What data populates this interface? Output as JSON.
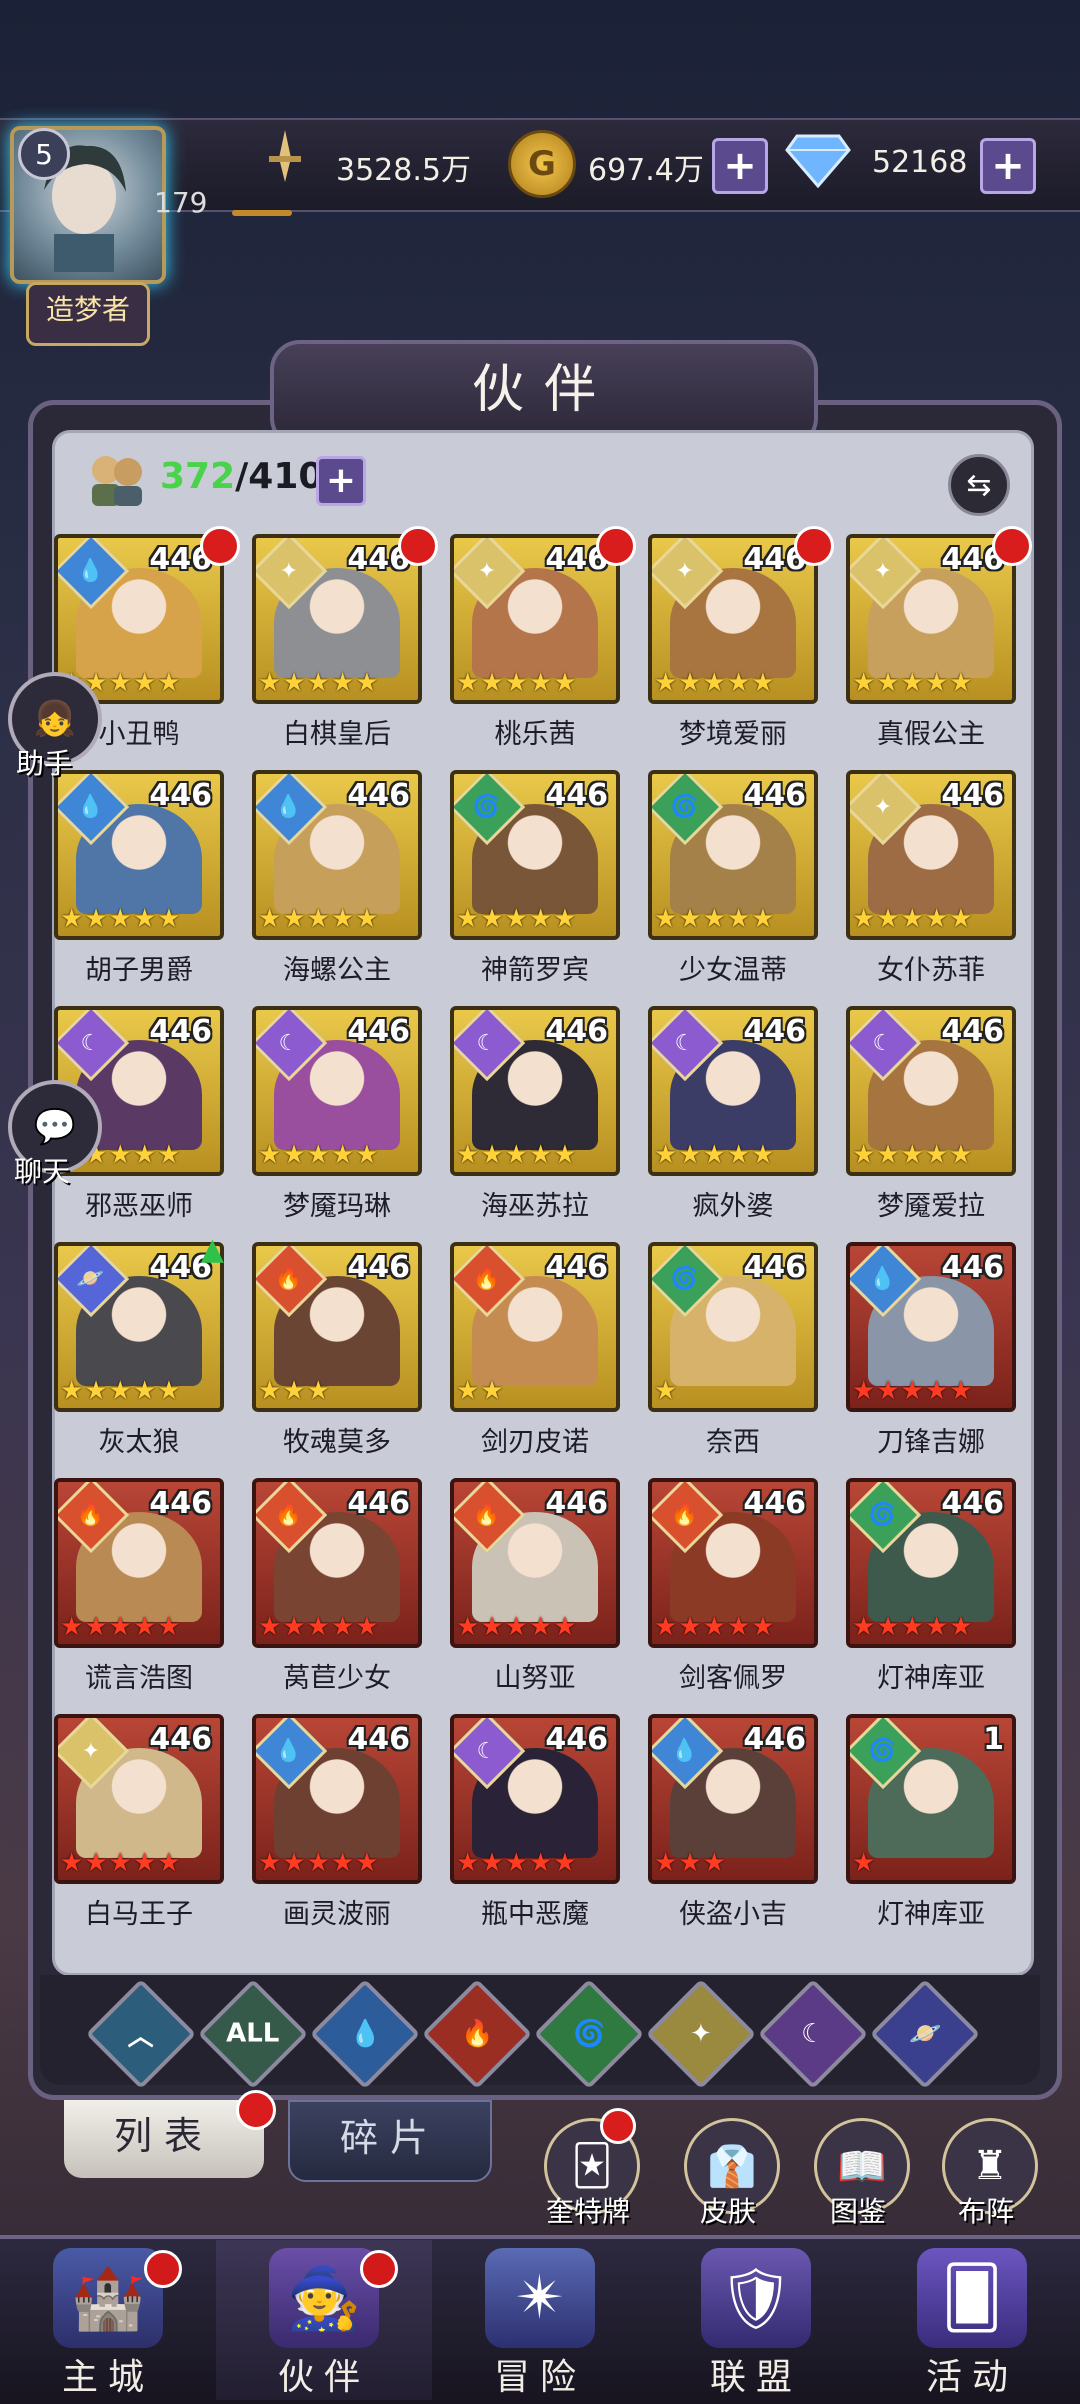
{
  "player": {
    "level": "5",
    "energy": "179",
    "title": "造梦者"
  },
  "resources": {
    "power": "3528.5万",
    "gold": "697.4万",
    "diamonds": "52168"
  },
  "header": {
    "title": "伙伴"
  },
  "capacity": {
    "current": "372",
    "max": "/410"
  },
  "side": {
    "assistant": "助手",
    "chat": "聊天"
  },
  "heroes": [
    {
      "name": "小丑鸭",
      "level": "446",
      "frame": "gold",
      "element": "water",
      "stars": 5,
      "dot": true,
      "portrait": "#d6a34a"
    },
    {
      "name": "白棋皇后",
      "level": "446",
      "frame": "gold",
      "element": "light",
      "stars": 5,
      "dot": true,
      "portrait": "#8d8f92"
    },
    {
      "name": "桃乐茜",
      "level": "446",
      "frame": "gold",
      "element": "light",
      "stars": 5,
      "dot": true,
      "portrait": "#b5754a"
    },
    {
      "name": "梦境爱丽",
      "level": "446",
      "frame": "gold",
      "element": "light",
      "stars": 5,
      "dot": true,
      "portrait": "#a8743f"
    },
    {
      "name": "真假公主",
      "level": "446",
      "frame": "gold",
      "element": "light",
      "stars": 5,
      "dot": true,
      "portrait": "#c8a05e"
    },
    {
      "name": "胡子男爵",
      "level": "446",
      "frame": "gold",
      "element": "water",
      "stars": 5,
      "dot": false,
      "portrait": "#4f76a6"
    },
    {
      "name": "海螺公主",
      "level": "446",
      "frame": "gold",
      "element": "water",
      "stars": 5,
      "dot": false,
      "portrait": "#c6a05a"
    },
    {
      "name": "神箭罗宾",
      "level": "446",
      "frame": "gold",
      "element": "wind",
      "stars": 5,
      "dot": false,
      "portrait": "#7a5638"
    },
    {
      "name": "少女温蒂",
      "level": "446",
      "frame": "gold",
      "element": "wind",
      "stars": 5,
      "dot": false,
      "portrait": "#a38148"
    },
    {
      "name": "女仆苏菲",
      "level": "446",
      "frame": "gold",
      "element": "light",
      "stars": 5,
      "dot": false,
      "portrait": "#9d6c45"
    },
    {
      "name": "邪恶巫师",
      "level": "446",
      "frame": "gold",
      "element": "dark",
      "stars": 5,
      "dot": false,
      "portrait": "#5a3a64"
    },
    {
      "name": "梦魇玛琳",
      "level": "446",
      "frame": "gold",
      "element": "dark",
      "stars": 5,
      "dot": false,
      "portrait": "#9a4f9e"
    },
    {
      "name": "海巫苏拉",
      "level": "446",
      "frame": "gold",
      "element": "dark",
      "stars": 5,
      "dot": false,
      "portrait": "#2e2a36"
    },
    {
      "name": "疯外婆",
      "level": "446",
      "frame": "gold",
      "element": "dark",
      "stars": 5,
      "dot": false,
      "portrait": "#3b3d66"
    },
    {
      "name": "梦魇爱拉",
      "level": "446",
      "frame": "gold",
      "element": "dark",
      "stars": 5,
      "dot": false,
      "portrait": "#a6743e"
    },
    {
      "name": "灰太狼",
      "level": "446",
      "frame": "gold",
      "element": "cosmic",
      "stars": 5,
      "dot": false,
      "up": true,
      "portrait": "#4a4a4e"
    },
    {
      "name": "牧魂莫多",
      "level": "446",
      "frame": "gold",
      "element": "fire",
      "stars": 3,
      "dot": false,
      "portrait": "#6b4534"
    },
    {
      "name": "剑刃皮诺",
      "level": "446",
      "frame": "gold",
      "element": "fire",
      "stars": 2,
      "dot": false,
      "portrait": "#c58c52"
    },
    {
      "name": "奈西",
      "level": "446",
      "frame": "gold",
      "element": "wind",
      "stars": 1,
      "dot": false,
      "portrait": "#d7b26a"
    },
    {
      "name": "刀锋吉娜",
      "level": "446",
      "frame": "red",
      "element": "water",
      "stars": 5,
      "dot": false,
      "portrait": "#8a95a8"
    },
    {
      "name": "谎言浩图",
      "level": "446",
      "frame": "red",
      "element": "fire",
      "stars": 5,
      "dot": false,
      "portrait": "#b98a53"
    },
    {
      "name": "莴苣少女",
      "level": "446",
      "frame": "red",
      "element": "fire",
      "stars": 5,
      "dot": false,
      "portrait": "#7a4433"
    },
    {
      "name": "山努亚",
      "level": "446",
      "frame": "red",
      "element": "fire",
      "stars": 5,
      "dot": false,
      "portrait": "#c9c2b5"
    },
    {
      "name": "剑客佩罗",
      "level": "446",
      "frame": "red",
      "element": "fire",
      "stars": 5,
      "dot": false,
      "portrait": "#8b3a26"
    },
    {
      "name": "灯神库亚",
      "level": "446",
      "frame": "red",
      "element": "wind",
      "stars": 5,
      "dot": false,
      "portrait": "#3e5a4c"
    },
    {
      "name": "白马王子",
      "level": "446",
      "frame": "red",
      "element": "light",
      "stars": 5,
      "dot": false,
      "portrait": "#d0b88a"
    },
    {
      "name": "画灵波丽",
      "level": "446",
      "frame": "red",
      "element": "water",
      "stars": 5,
      "dot": false,
      "portrait": "#6d4032"
    },
    {
      "name": "瓶中恶魔",
      "level": "446",
      "frame": "red",
      "element": "dark",
      "stars": 5,
      "dot": false,
      "portrait": "#2a2236"
    },
    {
      "name": "侠盗小吉",
      "level": "446",
      "frame": "red",
      "element": "water",
      "stars": 3,
      "dot": false,
      "portrait": "#5a4038"
    },
    {
      "name": "灯神库亚",
      "level": "1",
      "frame": "red",
      "element": "wind",
      "stars": 1,
      "dot": false,
      "portrait": "#4e6b5a"
    }
  ],
  "filters": [
    {
      "name": "filter-all-types",
      "label": "",
      "color": "#2c5d7a",
      "glyph": "︿"
    },
    {
      "name": "filter-all",
      "label": "ALL",
      "color": "#355a4a",
      "glyph": "ALL"
    },
    {
      "name": "filter-water",
      "label": "",
      "color": "#2d5c9a",
      "glyph": "💧"
    },
    {
      "name": "filter-fire",
      "label": "",
      "color": "#9a2e22",
      "glyph": "🔥"
    },
    {
      "name": "filter-wind",
      "label": "",
      "color": "#2f7a40",
      "glyph": "🌀"
    },
    {
      "name": "filter-light",
      "label": "",
      "color": "#9a8a40",
      "glyph": "✦"
    },
    {
      "name": "filter-dark",
      "label": "",
      "color": "#5b3a86",
      "glyph": "☾"
    },
    {
      "name": "filter-cosmic",
      "label": "",
      "color": "#3a3f8e",
      "glyph": "🪐"
    }
  ],
  "tabs": {
    "list": "列表",
    "shards": "碎片"
  },
  "shortcuts": {
    "card": "奎特牌",
    "skin": "皮肤",
    "codex": "图鉴",
    "formation": "布阵"
  },
  "nav": [
    {
      "label": "主城",
      "dot": true
    },
    {
      "label": "伙伴",
      "dot": true
    },
    {
      "label": "冒险",
      "dot": false
    },
    {
      "label": "联盟",
      "dot": false
    },
    {
      "label": "活动",
      "dot": false
    }
  ],
  "colors": {
    "accent": "#5b4b8e",
    "gold_frame": "#e9c84a",
    "red_frame": "#b84636",
    "badge_red": "#d91c1c"
  }
}
